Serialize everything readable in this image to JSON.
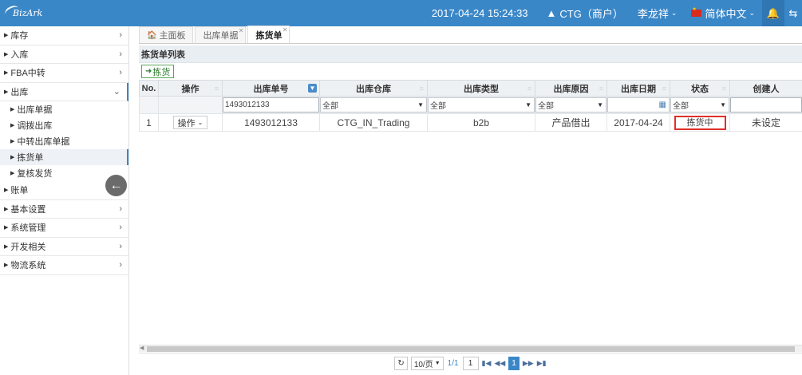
{
  "topbar": {
    "logo_text": "BizArk",
    "datetime": "2017-04-24 15:24:33",
    "merchant": "CTG（商户）",
    "user": "李龙祥",
    "language": "简体中文",
    "accent_color": "#3a87c8"
  },
  "sidebar": {
    "items": [
      {
        "label": "库存"
      },
      {
        "label": "入库"
      },
      {
        "label": "FBA中转"
      },
      {
        "label": "出库"
      },
      {
        "label": "账单"
      },
      {
        "label": "基本设置"
      },
      {
        "label": "系统管理"
      },
      {
        "label": "开发相关"
      },
      {
        "label": "物流系统"
      }
    ],
    "outbound_sub": [
      {
        "label": "出库单据"
      },
      {
        "label": "调拨出库"
      },
      {
        "label": "中转出库单据"
      },
      {
        "label": "拣货单"
      },
      {
        "label": "复核发货"
      }
    ]
  },
  "tabs": [
    {
      "label": "主面板"
    },
    {
      "label": "出库单据"
    },
    {
      "label": "拣货单"
    }
  ],
  "panel": {
    "title": "拣货单列表",
    "pick_button": "拣货"
  },
  "table": {
    "headers": [
      "No.",
      "操作",
      "出库单号",
      "出库仓库",
      "出库类型",
      "出库原因",
      "出库日期",
      "状态",
      "创建人"
    ],
    "filters": {
      "order_no": "1493012133",
      "warehouse": "全部",
      "type": "全部",
      "reason": "全部",
      "date": "",
      "status": "全部",
      "creator": ""
    },
    "rows": [
      {
        "no": "1",
        "action": "操作",
        "order_no": "1493012133",
        "warehouse": "CTG_IN_Trading",
        "type": "b2b",
        "reason": "产品借出",
        "date": "2017-04-24",
        "status": "拣货中",
        "creator": "未设定"
      }
    ]
  },
  "pager": {
    "page_size": "10/页",
    "page_info": "1/1",
    "page_input": "1",
    "current_page": "1"
  }
}
